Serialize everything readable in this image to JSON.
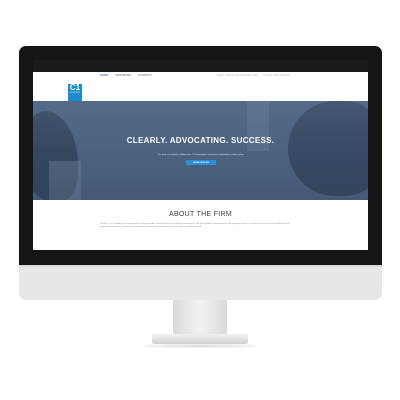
{
  "nav": {
    "items": [
      "HOME",
      "PARTNERS",
      "CONTACT"
    ]
  },
  "contact": {
    "email": "EMAIL: INFO@C1ADVOCATES.COM",
    "phone": "PHONE: (000) 000-0000"
  },
  "logo": {
    "text": "C1",
    "subtext": "ADVOCATES"
  },
  "hero": {
    "title": "CLEARLY. ADVOCATING. SUCCESS.",
    "subtitle": "The team consultants at Advocates C1 bring depth and proven leadership in public policy",
    "button": "WORK WITH US"
  },
  "about": {
    "title": "ABOUT THE FIRM",
    "body": "Clearly C1 is a leading firm comprised of seasoned public advocates and consulting professionals. The firm provides representative and advisory services to clients across numerous industries and government agencies. Our team has decades of experience working at the local, state, and federal levels."
  },
  "colors": {
    "accent": "#1e8bcf",
    "hero_bg": "#4d6584",
    "frame": "#151515",
    "chin": "#e6e7e8"
  }
}
